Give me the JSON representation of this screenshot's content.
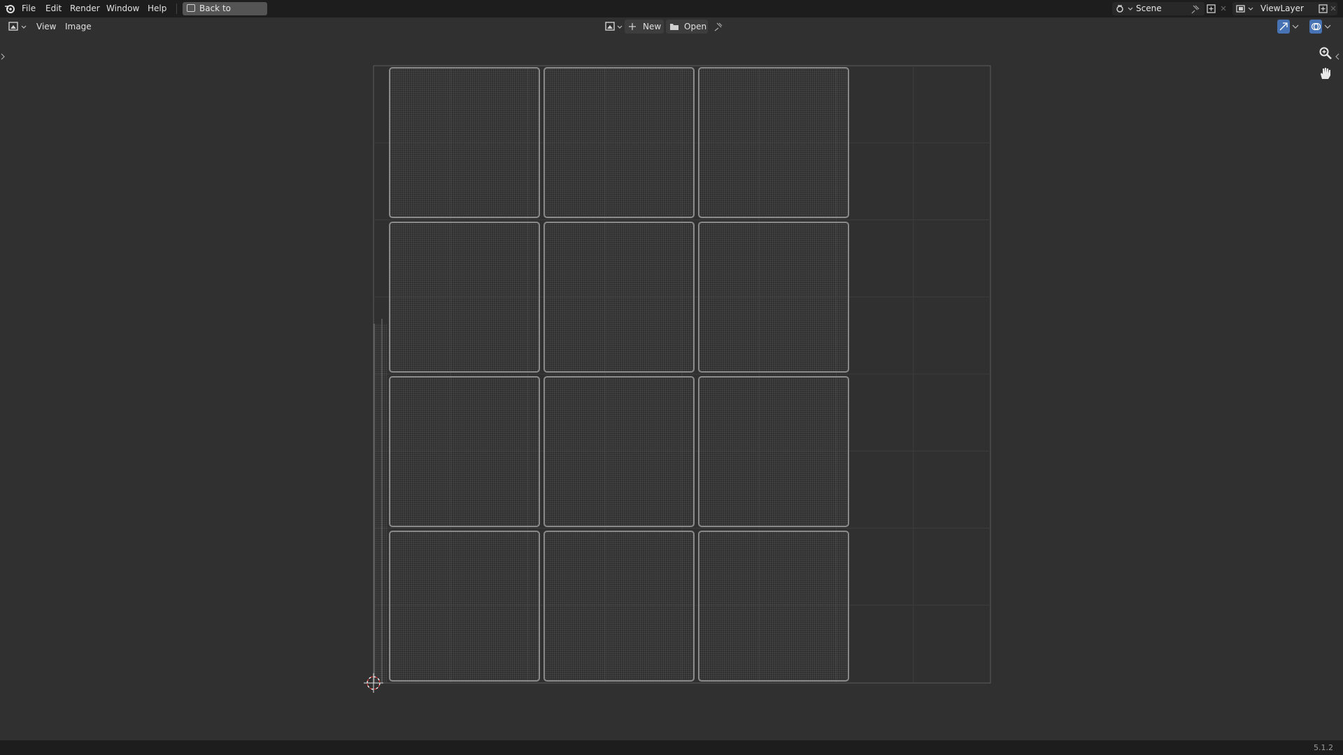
{
  "topbar": {
    "menus": [
      "File",
      "Edit",
      "Render",
      "Window",
      "Help"
    ],
    "back_button": "Back to Previous",
    "scene": "Scene",
    "view_layer": "ViewLayer"
  },
  "header": {
    "editor_menus": [
      "View",
      "Image"
    ],
    "new_button": "New",
    "open_button": "Open"
  },
  "uv_editor": {
    "grid_rows": 4,
    "grid_cols": 3
  },
  "status": {
    "version": "5.1.2"
  },
  "colors": {
    "background": "#303030",
    "topbar": "#1d1d1d",
    "uv_wire": "#8a8a8a",
    "accent": "#4772b3"
  }
}
